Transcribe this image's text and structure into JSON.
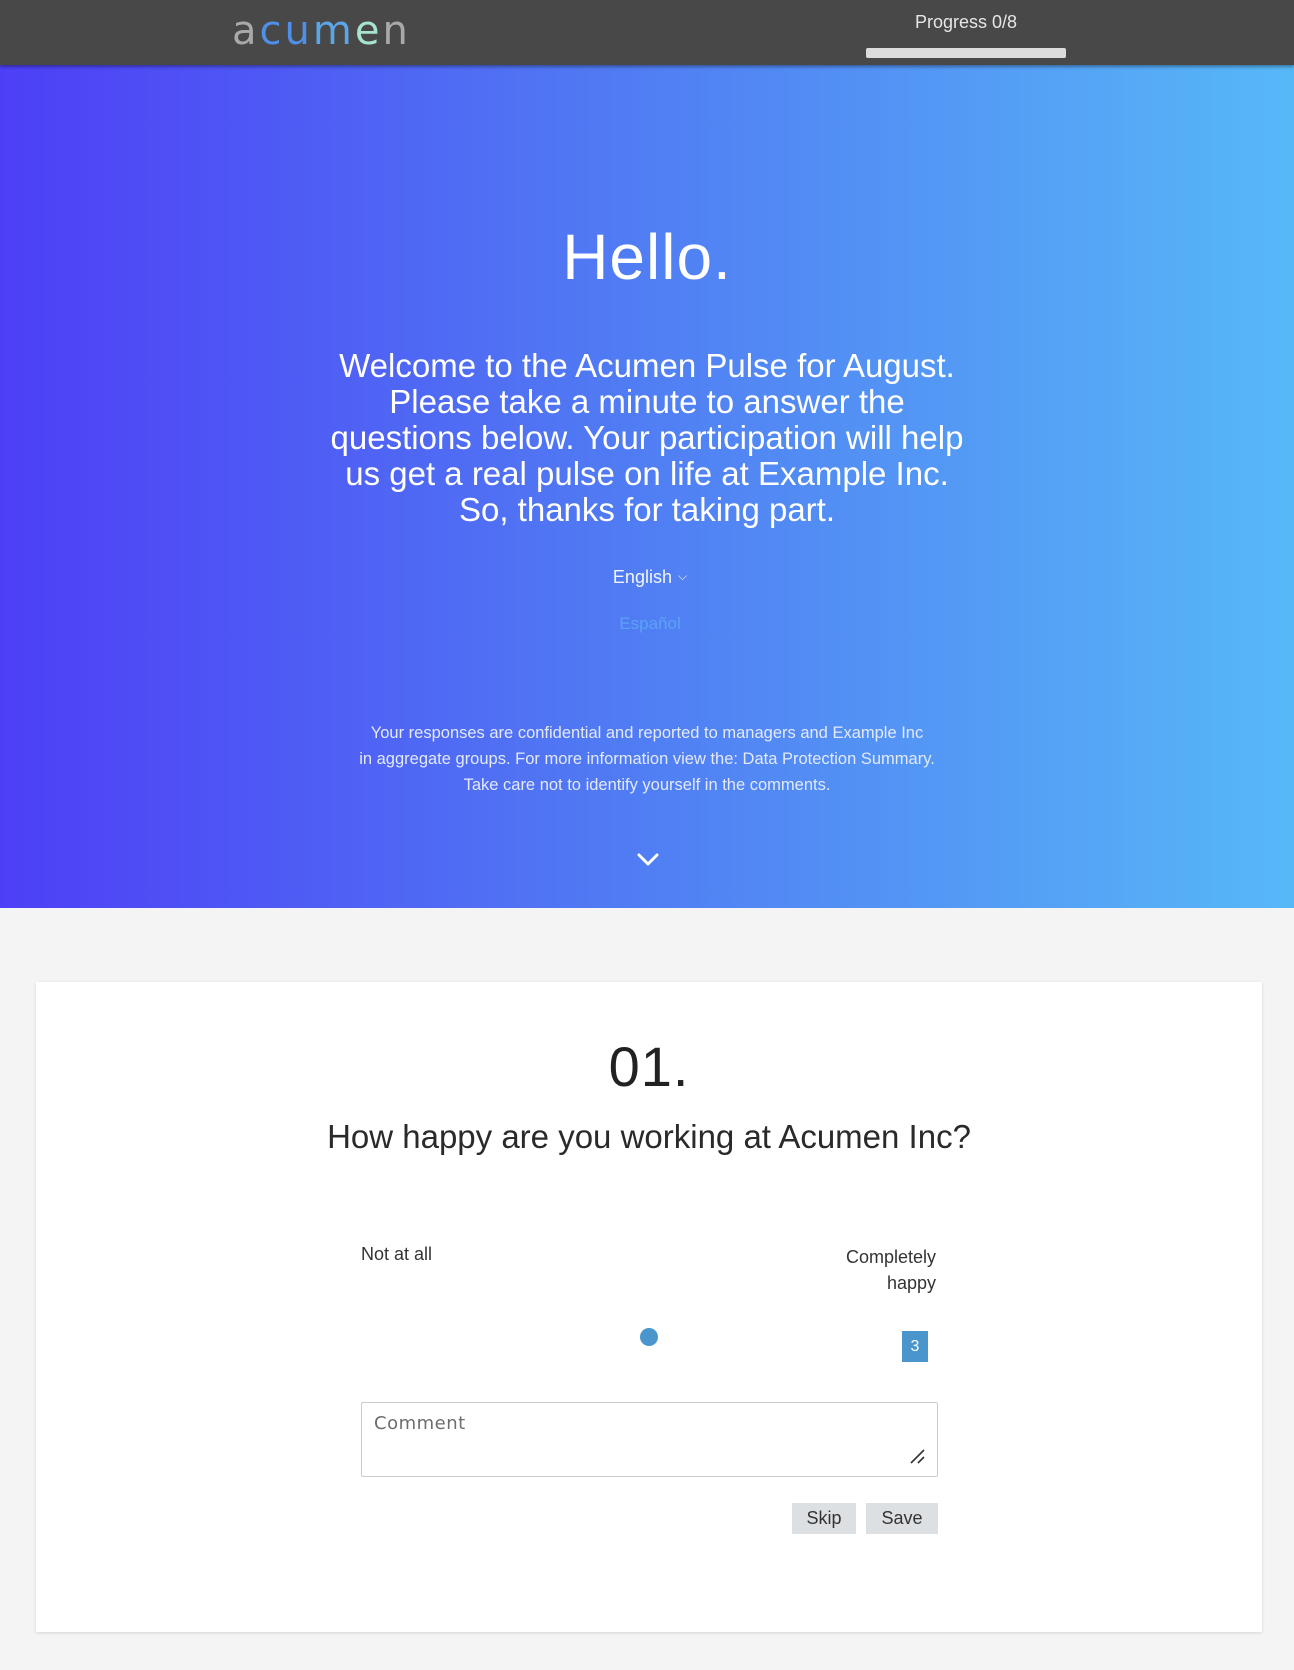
{
  "header": {
    "logo": {
      "letters": [
        "a",
        "c",
        "u",
        "m",
        "e",
        "n"
      ],
      "letter_colors": [
        "#a9a9a9",
        "#4f8fe8",
        "#4f8fe8",
        "#5aa6e6",
        "#a6e3d0",
        "#a9a9a9"
      ]
    },
    "progress": {
      "label": "Progress 0/8",
      "value": 0,
      "total": 8
    }
  },
  "hero": {
    "title": "Hello.",
    "welcome": "Welcome to the Acumen Pulse for August. Please take a minute to answer the questions below. Your participation will help us get a real pulse on life at Example Inc. So, thanks for taking part.",
    "language": {
      "selected": "English",
      "options": [
        "Español"
      ]
    },
    "confidentiality": [
      "Your responses are confidential and reported to managers and Example Inc",
      "in aggregate groups. For more information view the: Data Protection Summary.",
      "Take care not to identify yourself in the comments."
    ],
    "scroll_icon": "chevron-down-icon"
  },
  "question": {
    "number": "01.",
    "text": "How happy are you working at Acumen Inc?",
    "scale_min_label": "Not at all",
    "scale_max_label_lines": [
      "Completely",
      "happy"
    ],
    "slider": {
      "min": 1,
      "max": 5,
      "value": 3,
      "value_label": "3"
    },
    "comment_placeholder": "Comment",
    "skip_label": "Skip",
    "save_label": "Save"
  },
  "colors": {
    "topbar": "#484848",
    "hero_gradient_start": "#4d3ff6",
    "hero_gradient_end": "#57b8f7",
    "accent": "#4a96cc",
    "button_bg": "#dde0e3"
  }
}
